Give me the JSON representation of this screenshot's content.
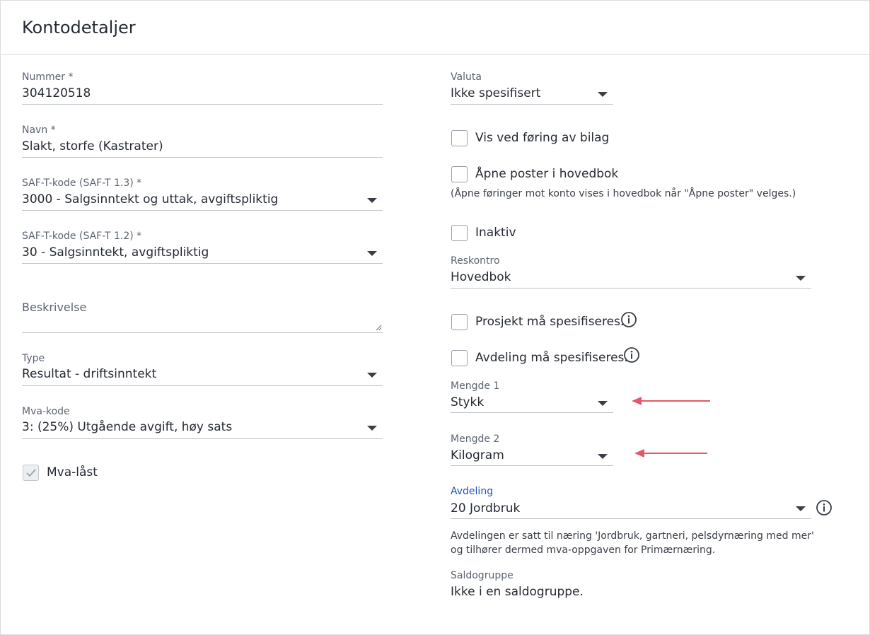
{
  "title": "Kontodetaljer",
  "left": {
    "nummer": {
      "label": "Nummer *",
      "value": "304120518"
    },
    "navn": {
      "label": "Navn *",
      "value": "Slakt, storfe (Kastrater)"
    },
    "saft13": {
      "label": "SAF-T-kode (SAF-T 1.3) *",
      "value": "3000 - Salgsinntekt og uttak, avgiftspliktig"
    },
    "saft12": {
      "label": "SAF-T-kode (SAF-T 1.2) *",
      "value": "30 - Salgsinntekt, avgiftspliktig"
    },
    "beskrivelse": {
      "placeholder": "Beskrivelse"
    },
    "type": {
      "label": "Type",
      "value": "Resultat - driftsinntekt"
    },
    "mvakode": {
      "label": "Mva-kode",
      "value": "3: (25%) Utgående avgift, høy sats"
    },
    "mvalast": {
      "label": "Mva-låst"
    }
  },
  "right": {
    "valuta": {
      "label": "Valuta",
      "value": "Ikke spesifisert"
    },
    "vis_ved_foring": {
      "label": "Vis ved føring av bilag"
    },
    "apne_poster": {
      "label": "Åpne poster i hovedbok",
      "hint": "(Åpne føringer mot konto vises i hovedbok når \"Åpne poster\" velges.)"
    },
    "inaktiv": {
      "label": "Inaktiv"
    },
    "reskontro": {
      "label": "Reskontro",
      "value": "Hovedbok"
    },
    "prosjekt": {
      "label": "Prosjekt må spesifiseres."
    },
    "avdeling_spes": {
      "label": "Avdeling må spesifiseres."
    },
    "mengde1": {
      "label": "Mengde 1",
      "value": "Stykk"
    },
    "mengde2": {
      "label": "Mengde 2",
      "value": "Kilogram"
    },
    "avdeling": {
      "label": "Avdeling",
      "value": "20 Jordbruk",
      "note_line1": "Avdelingen er satt til næring 'Jordbruk, gartneri, pelsdyrnæring med mer'",
      "note_line2": "og tilhører dermed mva-oppgaven for Primærnæring."
    },
    "saldogruppe": {
      "label": "Saldogruppe",
      "value": "Ikke i en saldogruppe."
    }
  },
  "colors": {
    "accent": "#1d4fc4",
    "arrow": "#e05a6a",
    "border": "#d9dce1"
  }
}
